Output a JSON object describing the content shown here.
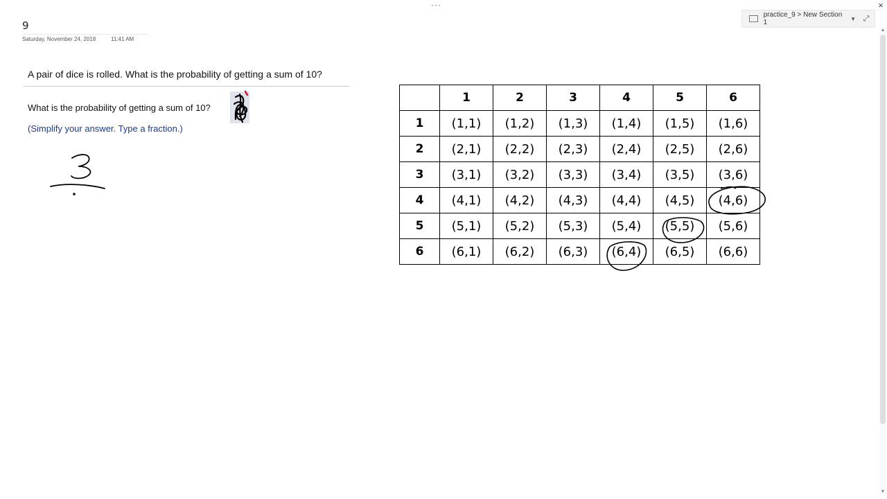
{
  "chrome": {
    "more_label": "···",
    "close_label": "×",
    "breadcrumb": "practice_9 > New Section 1",
    "dropdown_caret": "▼",
    "expand_label": "⤢"
  },
  "page": {
    "title": "9",
    "date": "Saturday, November 24, 2018",
    "time": "11:41 AM"
  },
  "question": {
    "prompt": "A pair of dice is rolled.  What is the probability of getting a sum of 10?",
    "sub_prompt": "What is the probability of getting a sum of 10?",
    "hint": "(Simplify your answer. Type a fraction.)"
  },
  "dice_table": {
    "col_headers": [
      "1",
      "2",
      "3",
      "4",
      "5",
      "6"
    ],
    "row_headers": [
      "1",
      "2",
      "3",
      "4",
      "5",
      "6"
    ],
    "rows": [
      [
        "(1,1)",
        "(1,2)",
        "(1,3)",
        "(1,4)",
        "(1,5)",
        "(1,6)"
      ],
      [
        "(2,1)",
        "(2,2)",
        "(2,3)",
        "(2,4)",
        "(2,5)",
        "(2,6)"
      ],
      [
        "(3,1)",
        "(3,2)",
        "(3,3)",
        "(3,4)",
        "(3,5)",
        "(3,6)"
      ],
      [
        "(4,1)",
        "(4,2)",
        "(4,3)",
        "(4,4)",
        "(4,5)",
        "(4,6)"
      ],
      [
        "(5,1)",
        "(5,2)",
        "(5,3)",
        "(5,4)",
        "(5,5)",
        "(5,6)"
      ],
      [
        "(6,1)",
        "(6,2)",
        "(6,3)",
        "(6,4)",
        "(6,5)",
        "(6,6)"
      ]
    ],
    "circled_cells": [
      "(4,6)",
      "(5,5)",
      "(6,4)"
    ]
  },
  "handwriting": {
    "numerator": "3",
    "ink_color": "#000000"
  },
  "colors": {
    "hint_text": "#1e3a8a",
    "answer_box": "#dfe3ee",
    "nav_bg": "#f3f3f3"
  }
}
